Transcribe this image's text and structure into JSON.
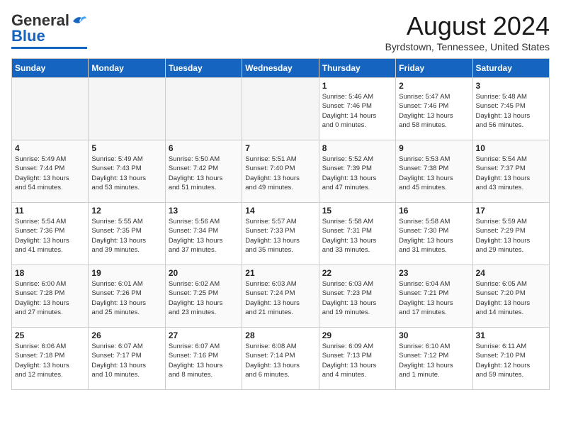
{
  "logo": {
    "general": "General",
    "blue": "Blue"
  },
  "title": {
    "month_year": "August 2024",
    "location": "Byrdstown, Tennessee, United States"
  },
  "headers": [
    "Sunday",
    "Monday",
    "Tuesday",
    "Wednesday",
    "Thursday",
    "Friday",
    "Saturday"
  ],
  "weeks": [
    [
      {
        "day": "",
        "info": ""
      },
      {
        "day": "",
        "info": ""
      },
      {
        "day": "",
        "info": ""
      },
      {
        "day": "",
        "info": ""
      },
      {
        "day": "1",
        "info": "Sunrise: 5:46 AM\nSunset: 7:46 PM\nDaylight: 14 hours\nand 0 minutes."
      },
      {
        "day": "2",
        "info": "Sunrise: 5:47 AM\nSunset: 7:46 PM\nDaylight: 13 hours\nand 58 minutes."
      },
      {
        "day": "3",
        "info": "Sunrise: 5:48 AM\nSunset: 7:45 PM\nDaylight: 13 hours\nand 56 minutes."
      }
    ],
    [
      {
        "day": "4",
        "info": "Sunrise: 5:49 AM\nSunset: 7:44 PM\nDaylight: 13 hours\nand 54 minutes."
      },
      {
        "day": "5",
        "info": "Sunrise: 5:49 AM\nSunset: 7:43 PM\nDaylight: 13 hours\nand 53 minutes."
      },
      {
        "day": "6",
        "info": "Sunrise: 5:50 AM\nSunset: 7:42 PM\nDaylight: 13 hours\nand 51 minutes."
      },
      {
        "day": "7",
        "info": "Sunrise: 5:51 AM\nSunset: 7:40 PM\nDaylight: 13 hours\nand 49 minutes."
      },
      {
        "day": "8",
        "info": "Sunrise: 5:52 AM\nSunset: 7:39 PM\nDaylight: 13 hours\nand 47 minutes."
      },
      {
        "day": "9",
        "info": "Sunrise: 5:53 AM\nSunset: 7:38 PM\nDaylight: 13 hours\nand 45 minutes."
      },
      {
        "day": "10",
        "info": "Sunrise: 5:54 AM\nSunset: 7:37 PM\nDaylight: 13 hours\nand 43 minutes."
      }
    ],
    [
      {
        "day": "11",
        "info": "Sunrise: 5:54 AM\nSunset: 7:36 PM\nDaylight: 13 hours\nand 41 minutes."
      },
      {
        "day": "12",
        "info": "Sunrise: 5:55 AM\nSunset: 7:35 PM\nDaylight: 13 hours\nand 39 minutes."
      },
      {
        "day": "13",
        "info": "Sunrise: 5:56 AM\nSunset: 7:34 PM\nDaylight: 13 hours\nand 37 minutes."
      },
      {
        "day": "14",
        "info": "Sunrise: 5:57 AM\nSunset: 7:33 PM\nDaylight: 13 hours\nand 35 minutes."
      },
      {
        "day": "15",
        "info": "Sunrise: 5:58 AM\nSunset: 7:31 PM\nDaylight: 13 hours\nand 33 minutes."
      },
      {
        "day": "16",
        "info": "Sunrise: 5:58 AM\nSunset: 7:30 PM\nDaylight: 13 hours\nand 31 minutes."
      },
      {
        "day": "17",
        "info": "Sunrise: 5:59 AM\nSunset: 7:29 PM\nDaylight: 13 hours\nand 29 minutes."
      }
    ],
    [
      {
        "day": "18",
        "info": "Sunrise: 6:00 AM\nSunset: 7:28 PM\nDaylight: 13 hours\nand 27 minutes."
      },
      {
        "day": "19",
        "info": "Sunrise: 6:01 AM\nSunset: 7:26 PM\nDaylight: 13 hours\nand 25 minutes."
      },
      {
        "day": "20",
        "info": "Sunrise: 6:02 AM\nSunset: 7:25 PM\nDaylight: 13 hours\nand 23 minutes."
      },
      {
        "day": "21",
        "info": "Sunrise: 6:03 AM\nSunset: 7:24 PM\nDaylight: 13 hours\nand 21 minutes."
      },
      {
        "day": "22",
        "info": "Sunrise: 6:03 AM\nSunset: 7:23 PM\nDaylight: 13 hours\nand 19 minutes."
      },
      {
        "day": "23",
        "info": "Sunrise: 6:04 AM\nSunset: 7:21 PM\nDaylight: 13 hours\nand 17 minutes."
      },
      {
        "day": "24",
        "info": "Sunrise: 6:05 AM\nSunset: 7:20 PM\nDaylight: 13 hours\nand 14 minutes."
      }
    ],
    [
      {
        "day": "25",
        "info": "Sunrise: 6:06 AM\nSunset: 7:18 PM\nDaylight: 13 hours\nand 12 minutes."
      },
      {
        "day": "26",
        "info": "Sunrise: 6:07 AM\nSunset: 7:17 PM\nDaylight: 13 hours\nand 10 minutes."
      },
      {
        "day": "27",
        "info": "Sunrise: 6:07 AM\nSunset: 7:16 PM\nDaylight: 13 hours\nand 8 minutes."
      },
      {
        "day": "28",
        "info": "Sunrise: 6:08 AM\nSunset: 7:14 PM\nDaylight: 13 hours\nand 6 minutes."
      },
      {
        "day": "29",
        "info": "Sunrise: 6:09 AM\nSunset: 7:13 PM\nDaylight: 13 hours\nand 4 minutes."
      },
      {
        "day": "30",
        "info": "Sunrise: 6:10 AM\nSunset: 7:12 PM\nDaylight: 13 hours\nand 1 minute."
      },
      {
        "day": "31",
        "info": "Sunrise: 6:11 AM\nSunset: 7:10 PM\nDaylight: 12 hours\nand 59 minutes."
      }
    ]
  ]
}
